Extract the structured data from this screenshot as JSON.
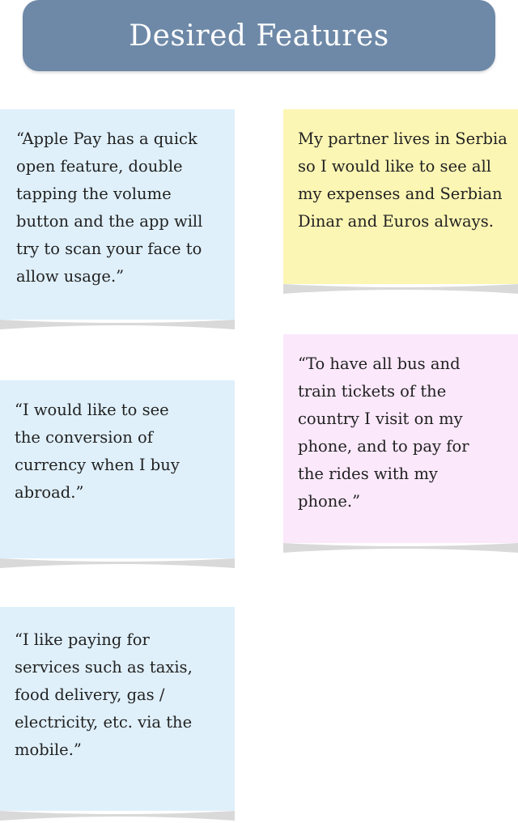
{
  "header": {
    "title": "Desired Features"
  },
  "colors": {
    "header_bg": "#6e89a8",
    "note_blue": "#dff0fb",
    "note_yellow": "#fcf6b4",
    "note_pink": "#fbe8fb",
    "curl_shadow": "#d9d9d9"
  },
  "notes": [
    {
      "text": "“Apple Pay has a quick open feature, double tapping the volume button and the app will try to scan your face to allow usage.”"
    },
    {
      "text": "My partner lives in Serbia so I would like to see all my expenses and Serbian Dinar and Euros always."
    },
    {
      "text": "“I would like to see the conversion of currency when I buy abroad.”"
    },
    {
      "text": "“To have all bus and train tickets of the country I visit on my phone, and to pay for the rides with my phone.”"
    },
    {
      "text": "“I like paying for services such as taxis, food delivery, gas / electricity, etc. via the mobile.”"
    }
  ]
}
